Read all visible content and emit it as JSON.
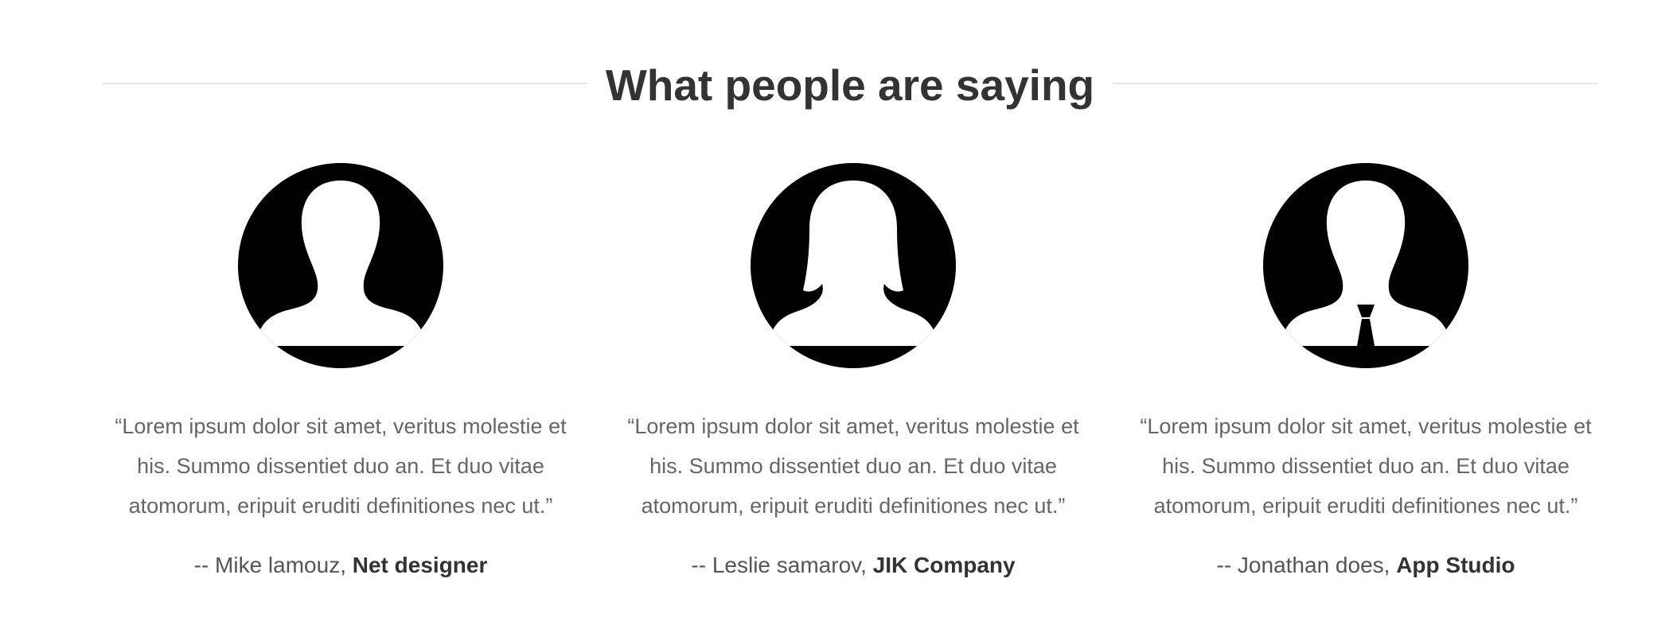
{
  "section": {
    "title": "What people are saying"
  },
  "testimonials": [
    {
      "avatar": "male-user-silhouette-icon",
      "quote": "“Lorem ipsum dolor sit amet, veritus molestie et his. Summo dissentiet duo an. Et duo vitae atomorum, eripuit eruditi definitiones nec ut.”",
      "author_prefix": "-- Mike lamouz, ",
      "company": "Net designer"
    },
    {
      "avatar": "female-user-silhouette-icon",
      "quote": "“Lorem ipsum dolor sit amet, veritus molestie et his. Summo dissentiet duo an. Et duo vitae atomorum, eripuit eruditi definitiones nec ut.”",
      "author_prefix": "-- Leslie samarov, ",
      "company": "JIK Company"
    },
    {
      "avatar": "businessman-user-silhouette-icon",
      "quote": "“Lorem ipsum dolor sit amet, veritus molestie et his. Summo dissentiet duo an. Et duo vitae atomorum, eripuit eruditi definitiones nec ut.”",
      "author_prefix": "-- Jonathan does, ",
      "company": "App Studio"
    }
  ],
  "colors": {
    "heading": "#333333",
    "body_text": "#666666",
    "divider": "#e6e6e6",
    "avatar": "#000000"
  }
}
